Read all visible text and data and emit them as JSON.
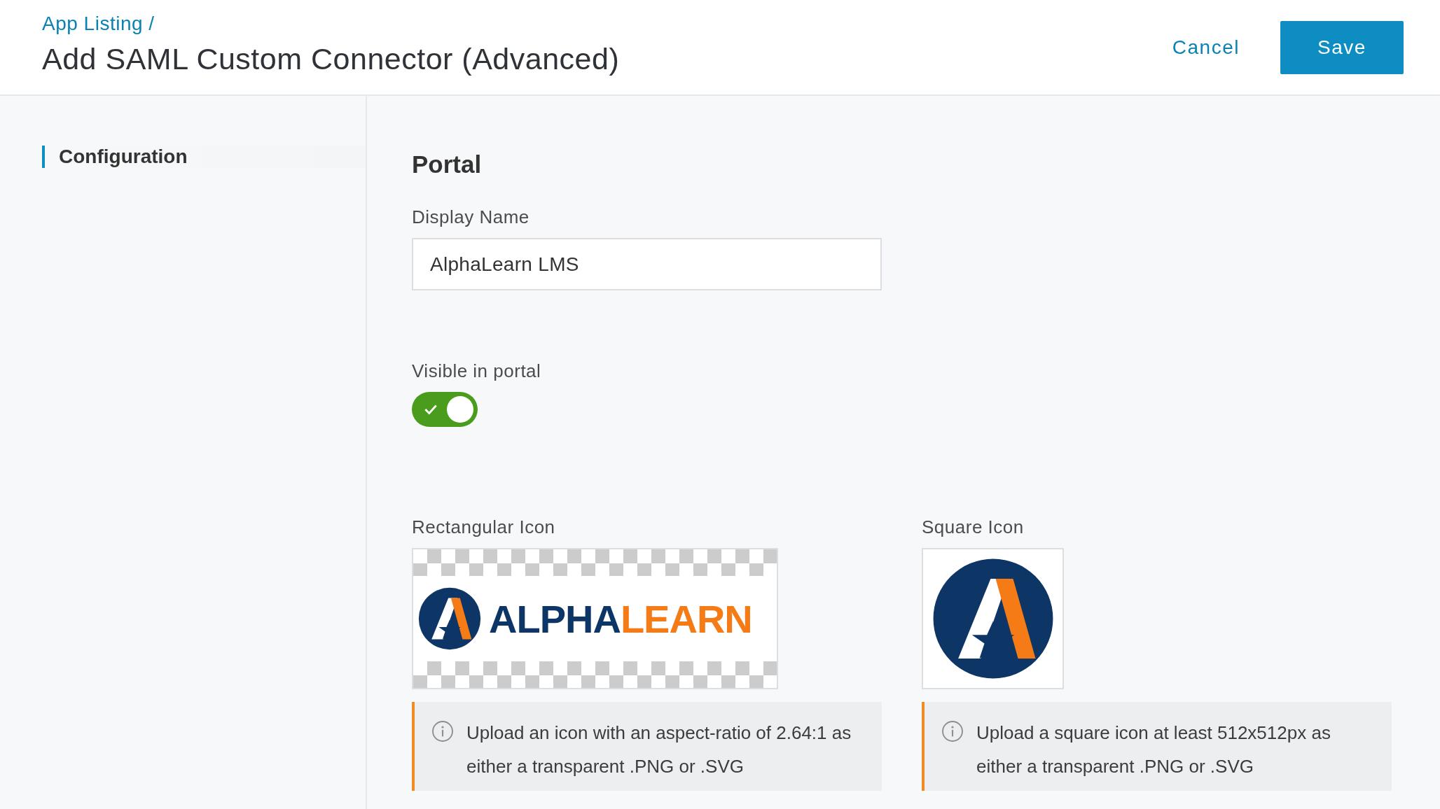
{
  "header": {
    "breadcrumb": "App Listing /",
    "title": "Add SAML Custom Connector (Advanced)",
    "cancel": "Cancel",
    "save": "Save"
  },
  "sidebar": {
    "items": [
      {
        "label": "Configuration",
        "selected": true
      }
    ]
  },
  "section": {
    "title": "Portal",
    "display_name": {
      "label": "Display Name",
      "value": "AlphaLearn LMS"
    },
    "visible_in_portal": {
      "label": "Visible in portal",
      "on": true
    },
    "icons": [
      {
        "kind": "rectangular",
        "label": "Rectangular Icon",
        "wordmark": [
          "ALPHA",
          "LEARN"
        ],
        "hint": "Upload an icon with an aspect-ratio of 2.64:1 as either a transparent .PNG or .SVG"
      },
      {
        "kind": "square",
        "label": "Square Icon",
        "hint": "Upload a square icon at least 512x512px as either a transparent .PNG or .SVG"
      }
    ]
  }
}
